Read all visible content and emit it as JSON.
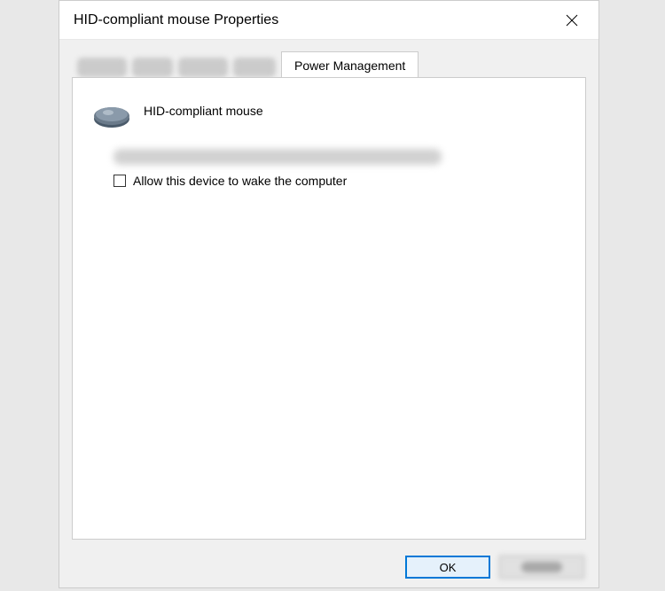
{
  "dialog": {
    "title": "HID-compliant mouse Properties"
  },
  "tabs": {
    "active": "Power Management"
  },
  "panel": {
    "device_name": "HID-compliant mouse",
    "checkbox_wake_label": "Allow this device to wake the computer",
    "checkbox_wake_checked": false
  },
  "buttons": {
    "ok": "OK"
  }
}
